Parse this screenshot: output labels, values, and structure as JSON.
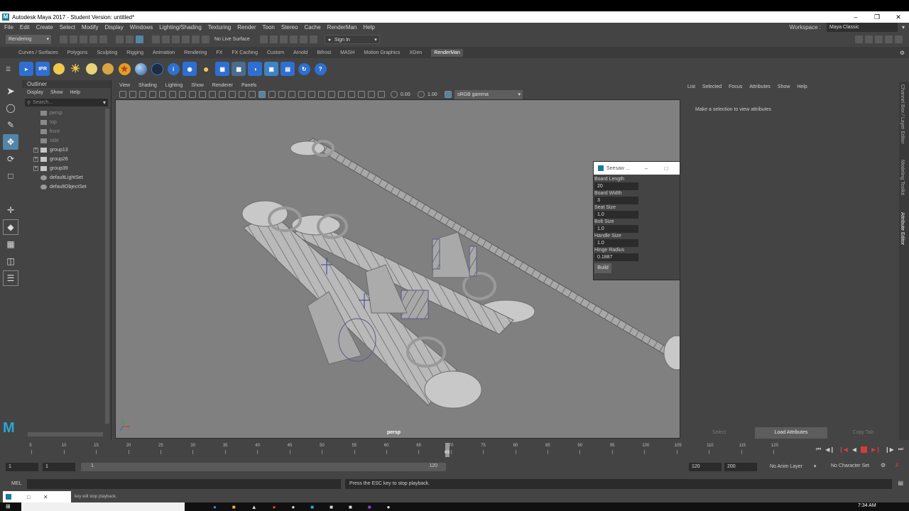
{
  "window": {
    "title": "Autodesk Maya 2017 - Student Version: untitled*"
  },
  "menubar": {
    "items": [
      "File",
      "Edit",
      "Create",
      "Select",
      "Modify",
      "Display",
      "Windows",
      "Lighting/Shading",
      "Texturing",
      "Render",
      "Toon",
      "Stereo",
      "Cache",
      "RenderMan",
      "Help"
    ],
    "workspace_label": "Workspace :",
    "workspace_value": "Maya Classic"
  },
  "statusline": {
    "menuset": "Rendering",
    "live_surface": "No Live Surface",
    "sign_in": "Sign In"
  },
  "shelf": {
    "tabs": [
      "Curves / Surfaces",
      "Polygons",
      "Sculpting",
      "Rigging",
      "Animation",
      "Rendering",
      "FX",
      "FX Caching",
      "Custom",
      "Arnold",
      "Bifrost",
      "MASH",
      "Motion Graphics",
      "XGen",
      "RenderMan"
    ],
    "active_tab": "RenderMan",
    "ipr_label": "IPR"
  },
  "outliner": {
    "title": "Outliner",
    "menus": [
      "Display",
      "Show",
      "Help"
    ],
    "search_placeholder": "Search...",
    "items": [
      {
        "label": "persp",
        "hidden": true
      },
      {
        "label": "top",
        "hidden": true
      },
      {
        "label": "front",
        "hidden": true
      },
      {
        "label": "side",
        "hidden": true
      },
      {
        "label": "group13",
        "hidden": false
      },
      {
        "label": "group26",
        "hidden": false
      },
      {
        "label": "group39",
        "hidden": false
      },
      {
        "label": "defaultLightSet",
        "hidden": false
      },
      {
        "label": "defaultObjectSet",
        "hidden": false
      }
    ]
  },
  "viewport": {
    "menus": [
      "View",
      "Shading",
      "Lighting",
      "Show",
      "Renderer",
      "Panels"
    ],
    "exposure": "0.00",
    "gamma": "1.00",
    "colorspace": "sRGB gamma",
    "camera_label": "persp"
  },
  "seesaw_window": {
    "title": "Seesaw ...",
    "fields": [
      {
        "label": "Board Length",
        "value": "20"
      },
      {
        "label": "Board Width",
        "value": "3"
      },
      {
        "label": "Seat Size",
        "value": "1.0"
      },
      {
        "label": "Bolt Size",
        "value": "1.0"
      },
      {
        "label": "Handle Size",
        "value": "1.0"
      },
      {
        "label": "Hinge Radius",
        "value": "0.1887"
      }
    ],
    "build_label": "Build"
  },
  "attribute_editor": {
    "menus": [
      "List",
      "Selected",
      "Focus",
      "Attributes",
      "Show",
      "Help"
    ],
    "message": "Make a selection to view attributes",
    "buttons": [
      "Select",
      "Load Attributes",
      "Copy Tab"
    ]
  },
  "side_tabs": [
    "Channel Box / Layer Editor",
    "Modeling Toolkit",
    "Attribute Editor"
  ],
  "timeslider": {
    "ticks": [
      "5",
      "10",
      "15",
      "20",
      "25",
      "30",
      "35",
      "40",
      "45",
      "50",
      "55",
      "60",
      "65",
      "70",
      "75",
      "80",
      "85",
      "90",
      "95",
      "100",
      "105",
      "110",
      "115",
      "120"
    ],
    "current_frame": "69",
    "current_value": 69
  },
  "range": {
    "start": "1",
    "start2": "1",
    "slider_start": "1",
    "slider_end": "120",
    "end": "120",
    "end2": "200",
    "anim_layer": "No Anim Layer",
    "character_set": "No Character Set"
  },
  "command": {
    "label": "MEL",
    "feedback": "Press the ESC key to stop playback."
  },
  "helpline": {
    "text": "key will stop playback."
  },
  "taskbar": {
    "time": "7:34 AM"
  },
  "colors": {
    "viewport_bg": "#808080",
    "accent_blue": "#5285a6",
    "stop_red": "#d23c3c"
  }
}
